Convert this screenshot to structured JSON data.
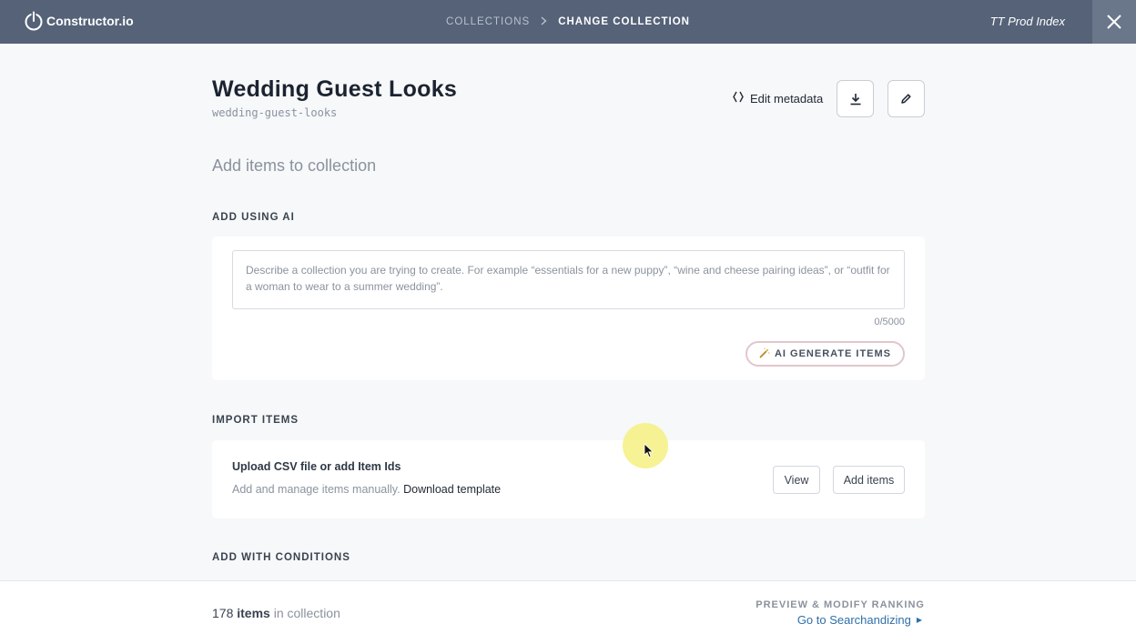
{
  "header": {
    "logo_text": "Constructor.io",
    "breadcrumbs": [
      "COLLECTIONS",
      "CHANGE COLLECTION"
    ],
    "index_name": "TT Prod Index"
  },
  "collection": {
    "title": "Wedding Guest Looks",
    "slug": "wedding-guest-looks",
    "edit_metadata_label": "Edit metadata"
  },
  "add_items": {
    "heading": "Add items to collection",
    "ai": {
      "label": "ADD USING AI",
      "placeholder": "Describe a collection you are trying to create. For example “essentials for a new puppy”, “wine and cheese pairing ideas”, or “outfit for a woman to wear to a summer wedding”.",
      "char_count": "0/5000",
      "generate_label": "AI GENERATE ITEMS"
    },
    "import": {
      "label": "IMPORT ITEMS",
      "title": "Upload CSV file or add Item Ids",
      "subtitle": "Add and manage items manually.",
      "template_link": "Download template",
      "view_label": "View",
      "add_items_label": "Add items"
    },
    "conditions": {
      "label": "ADD WITH CONDITIONS"
    }
  },
  "footer": {
    "count": "178",
    "count_word": "items",
    "count_suffix": "in collection",
    "preview_label": "PREVIEW & MODIFY RANKING",
    "searchandize_link": "Go to Searchandizing"
  },
  "colors": {
    "topbar": "#556278",
    "link": "#2f6fa8",
    "ai_button_border": "#e2c6cc"
  }
}
